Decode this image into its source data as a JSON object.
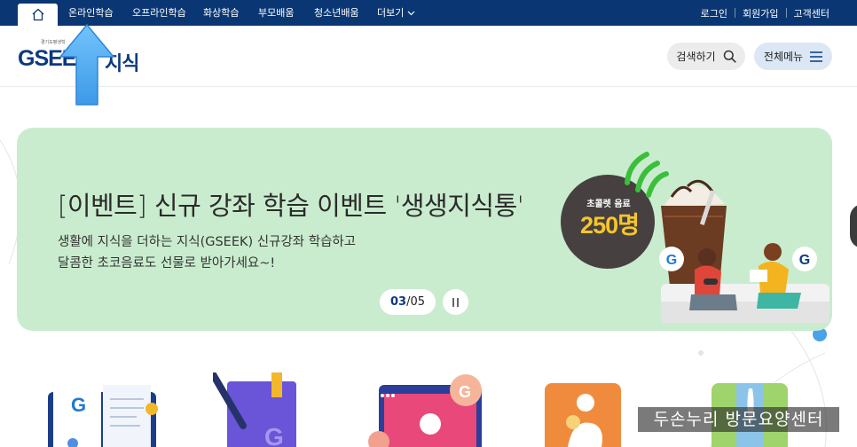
{
  "topnav": {
    "home_label": "home",
    "items": [
      "온라인학습",
      "오프라인학습",
      "화상학습",
      "부모배움",
      "청소년배움"
    ],
    "more_label": "더보기",
    "util": [
      "로그인",
      "회원가입",
      "고객센터"
    ]
  },
  "header": {
    "logo_small": "경기도평생학",
    "logo_brand": "GSEEK",
    "logo_suffix": "지식",
    "search_label": "검색하기",
    "menu_label": "전체메뉴"
  },
  "banner": {
    "title": "[이벤트] 신규 강좌 학습 이벤트 '생생지식통'",
    "desc_line1": "생활에 지식을 더하는 지식(GSEEK) 신규강좌 학습하고",
    "desc_line2": "달콤한 초코음료도 선물로 받아가세요~!",
    "pager_current": "03",
    "pager_total": "/05",
    "promo_small": "초콜렛 음료",
    "promo_big": "250명"
  },
  "watermark": "두손누리 방문요양센터",
  "colors": {
    "topbar": "#0a3773",
    "brand": "#0b3a7e",
    "banner_bg": "#c9ecce",
    "promo_accent": "#f6c62a",
    "arrow": "#4aa8f0"
  },
  "icons": [
    "home-icon",
    "chevron-down-icon",
    "search-icon",
    "hamburger-icon",
    "pause-icon"
  ]
}
